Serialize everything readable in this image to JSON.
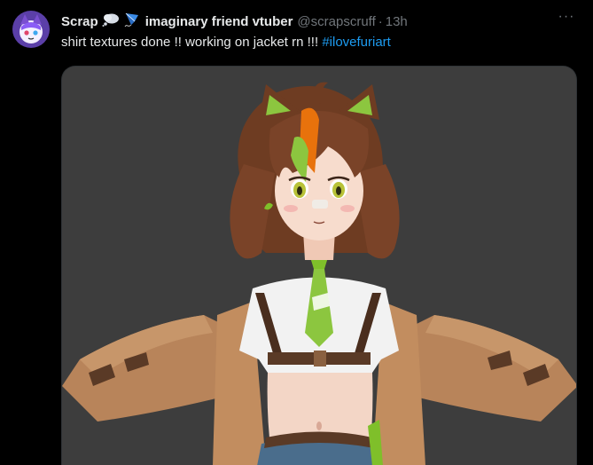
{
  "tweet": {
    "display_name": "Scrap",
    "display_name_suffix": "imaginary friend vtuber",
    "handle": "@scrapscruff",
    "separator": "·",
    "time": "13h",
    "more_glyph": "···",
    "text": "shirt textures done !! working on jacket rn !!! ",
    "hashtag": "#ilovefuriart"
  },
  "icons": {
    "avatar": "avatar-icon",
    "thought_bubble": "thought-bubble-icon",
    "kite": "kite-icon",
    "more": "more-options-icon"
  },
  "colors": {
    "background": "#000000",
    "text": "#e7e9ea",
    "muted": "#71767b",
    "link": "#1d9bf0",
    "media_background": "#3d3d3d"
  }
}
